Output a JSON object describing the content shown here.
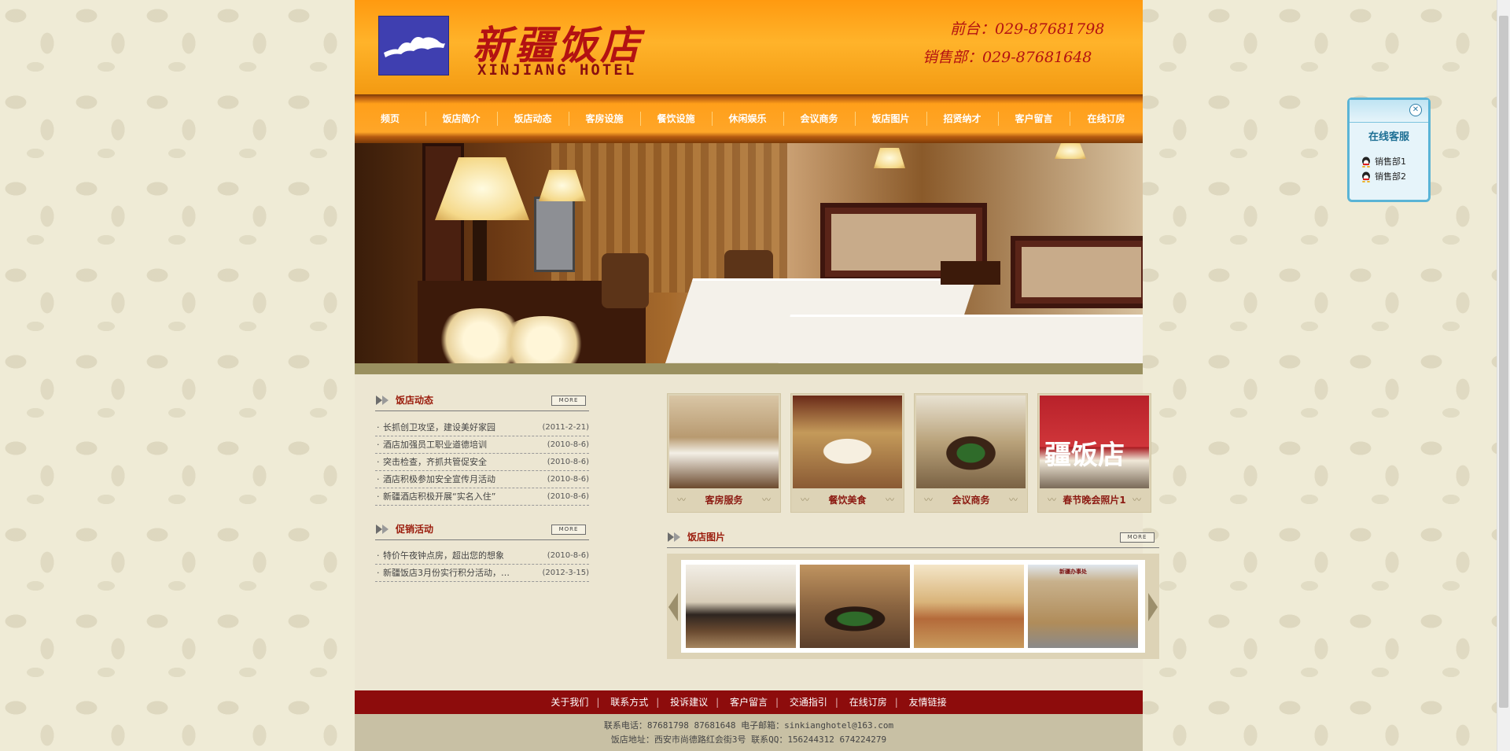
{
  "header": {
    "hotel_name_cn": "新疆饭店",
    "hotel_name_en": "XINJIANG HOTEL",
    "phone_front": "前台：029-87681798",
    "phone_sales": "销售部：029-87681648"
  },
  "nav": {
    "items": [
      {
        "label": "频页"
      },
      {
        "label": "饭店简介"
      },
      {
        "label": "饭店动态"
      },
      {
        "label": "客房设施"
      },
      {
        "label": "餐饮设施"
      },
      {
        "label": "休闲娱乐"
      },
      {
        "label": "会议商务"
      },
      {
        "label": "饭店图片"
      },
      {
        "label": "招贤纳才"
      },
      {
        "label": "客户留言"
      },
      {
        "label": "在线订房"
      }
    ]
  },
  "news": {
    "title": "饭店动态",
    "more": "MORE",
    "items": [
      {
        "text": "长抓创卫攻坚，建设美好家园",
        "date": "(2011-2-21)"
      },
      {
        "text": "酒店加强员工职业道德培训",
        "date": "(2010-8-6)"
      },
      {
        "text": "突击检查，齐抓共管促安全",
        "date": "(2010-8-6)"
      },
      {
        "text": "酒店积极参加安全宣传月活动",
        "date": "(2010-8-6)"
      },
      {
        "text": "新疆酒店积极开展“实名入住”",
        "date": "(2010-8-6)"
      }
    ]
  },
  "promo": {
    "title": "促销活动",
    "more": "MORE",
    "items": [
      {
        "text": "特价午夜钟点房，超出您的想象",
        "date": "(2010-8-6)"
      },
      {
        "text": "新疆饭店3月份实行积分活动，…",
        "date": "(2012-3-15)"
      }
    ]
  },
  "features": [
    {
      "label": "客房服务"
    },
    {
      "label": "餐饮美食"
    },
    {
      "label": "会议商务"
    },
    {
      "label": "春节晚会照片1"
    }
  ],
  "feature_thumb_text": "疆饭店",
  "gallery": {
    "title": "饭店图片",
    "more": "MORE",
    "building_sign": "新疆办事处"
  },
  "footer": {
    "links": [
      "关于我们",
      "联系方式",
      "投诉建议",
      "客户留言",
      "交通指引",
      "在线订房",
      "友情链接"
    ],
    "contact_line": "联系电话：87681798 87681648 电子邮箱：sinkianghotel@163.com",
    "address_line": "饭店地址：西安市尚德路红会街3号 联系QQ：156244312 674224279"
  },
  "service": {
    "title": "在线客服",
    "close_icon": "close-icon",
    "items": [
      {
        "label": "销售部1"
      },
      {
        "label": "销售部2"
      }
    ]
  },
  "colors": {
    "header_orange": "#ffa628",
    "title_red": "#9a1b0b",
    "footer_red": "#8d0c0c",
    "service_blue": "#5ab4d6"
  }
}
